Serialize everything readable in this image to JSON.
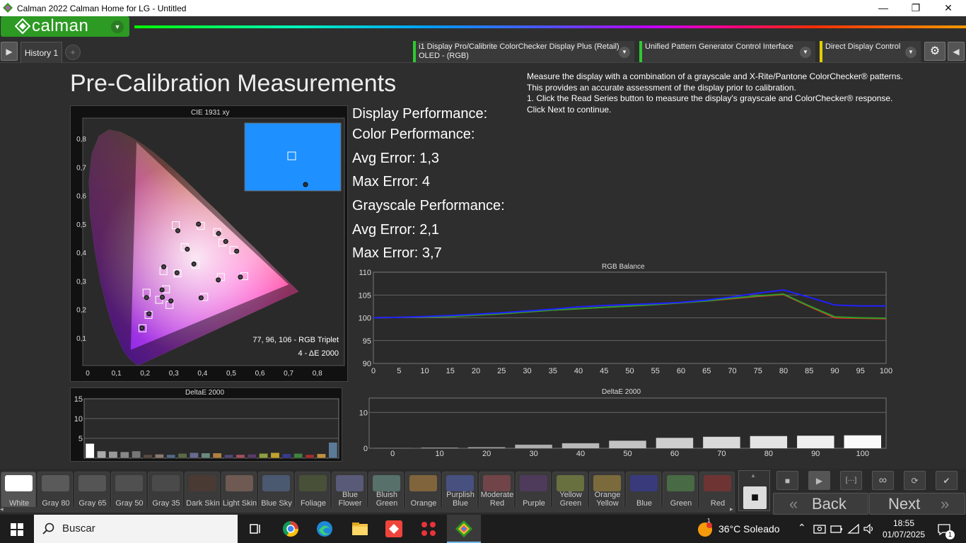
{
  "window": {
    "title": "Calman 2022 Calman Home for LG  - Untitled",
    "minimize": "—",
    "maximize": "❐",
    "close": "✕"
  },
  "logo": {
    "text": "calman",
    "drop": "▼"
  },
  "tabs": {
    "history": "History 1",
    "add": "+",
    "left_arrow": "▶",
    "right_arrow": "◀"
  },
  "devices": [
    {
      "line1": "i1 Display Pro/Calibrite ColorChecker Display Plus (Retail)",
      "line2": "OLED - (RGB)",
      "color": "#2fc92f"
    },
    {
      "line1": "Unified Pattern Generator Control Interface",
      "line2": "",
      "color": "#2fc92f"
    },
    {
      "line1": "Direct Display Control",
      "line2": "",
      "color": "#e0d000"
    }
  ],
  "page": {
    "title": "Pre-Calibration Measurements",
    "instructions": [
      "Measure the display with a combination of a grayscale and X-Rite/Pantone ColorChecker® patterns.",
      "This provides an accurate assessment of the display prior to calibration.",
      "1. Click the Read Series button to measure the display's grayscale and ColorChecker® response.",
      "Click Next to continue."
    ],
    "display_performance": "Display Performance:",
    "color_performance": "Color Performance:",
    "color_avg": "Avg Error: 1,3",
    "color_max": "Max Error: 4",
    "gray_performance": "Grayscale Performance:",
    "gray_avg": "Avg Error: 2,1",
    "gray_max": "Max Error: 3,7"
  },
  "chart_data": [
    {
      "type": "scatter",
      "title": "CIE 1931 xy",
      "xlim": [
        0,
        0.85
      ],
      "ylim": [
        0,
        0.85
      ],
      "x_ticks": [
        "0",
        "0,1",
        "0,2",
        "0,3",
        "0,4",
        "0,5",
        "0,6",
        "0,7",
        "0,8"
      ],
      "y_ticks": [
        "0,1",
        "0,2",
        "0,3",
        "0,4",
        "0,5",
        "0,6",
        "0,7",
        "0,8"
      ],
      "targets": [
        [
          0.313,
          0.329
        ],
        [
          0.376,
          0.359
        ],
        [
          0.273,
          0.273
        ],
        [
          0.249,
          0.236
        ],
        [
          0.338,
          0.421
        ],
        [
          0.264,
          0.337
        ],
        [
          0.394,
          0.496
        ],
        [
          0.205,
          0.261
        ],
        [
          0.307,
          0.498
        ],
        [
          0.451,
          0.474
        ],
        [
          0.464,
          0.316
        ],
        [
          0.545,
          0.319
        ],
        [
          0.406,
          0.246
        ],
        [
          0.285,
          0.218
        ],
        [
          0.469,
          0.437
        ],
        [
          0.508,
          0.411
        ],
        [
          0.212,
          0.183
        ],
        [
          0.191,
          0.136
        ]
      ],
      "measured": [
        [
          0.311,
          0.331
        ],
        [
          0.37,
          0.362
        ],
        [
          0.259,
          0.271
        ],
        [
          0.26,
          0.245
        ],
        [
          0.347,
          0.414
        ],
        [
          0.265,
          0.352
        ],
        [
          0.386,
          0.502
        ],
        [
          0.205,
          0.244
        ],
        [
          0.314,
          0.479
        ],
        [
          0.456,
          0.469
        ],
        [
          0.455,
          0.306
        ],
        [
          0.532,
          0.316
        ],
        [
          0.395,
          0.243
        ],
        [
          0.29,
          0.232
        ],
        [
          0.481,
          0.441
        ],
        [
          0.519,
          0.407
        ],
        [
          0.214,
          0.187
        ],
        [
          0.189,
          0.137
        ]
      ],
      "annotation_line1": "77, 96, 106 - RGB Triplet",
      "annotation_line2": "4 - ΔE 2000",
      "inset_color": "#1e90ff"
    },
    {
      "type": "line",
      "title": "RGB Balance",
      "x": [
        0,
        5,
        10,
        15,
        20,
        25,
        30,
        35,
        40,
        45,
        50,
        55,
        60,
        65,
        70,
        75,
        80,
        85,
        90,
        95,
        100
      ],
      "x_ticks": [
        "0",
        "5",
        "10",
        "15",
        "20",
        "25",
        "30",
        "35",
        "40",
        "45",
        "50",
        "55",
        "60",
        "65",
        "70",
        "75",
        "80",
        "85",
        "90",
        "95",
        "100"
      ],
      "y_ticks": [
        "90",
        "95",
        "100",
        "105",
        "110"
      ],
      "ylim": [
        90,
        110
      ],
      "series": [
        {
          "color": "#ff2020",
          "values": [
            100,
            100.1,
            100.2,
            100.3,
            100.6,
            100.9,
            101.3,
            101.7,
            102.0,
            102.3,
            102.6,
            102.9,
            103.3,
            103.7,
            104.2,
            104.7,
            105.1,
            102.5,
            100.0,
            99.9,
            99.8
          ]
        },
        {
          "color": "#2aa02a",
          "values": [
            100,
            100.1,
            100.2,
            100.3,
            100.6,
            100.9,
            101.3,
            101.7,
            102.0,
            102.3,
            102.6,
            102.9,
            103.3,
            103.7,
            104.3,
            104.8,
            105.2,
            102.6,
            100.2,
            100.0,
            99.9
          ]
        },
        {
          "color": "#2020ff",
          "values": [
            100,
            100.1,
            100.3,
            100.5,
            100.8,
            101.1,
            101.5,
            101.9,
            102.4,
            102.7,
            102.9,
            103.1,
            103.4,
            103.9,
            104.6,
            105.4,
            106.1,
            104.5,
            102.8,
            102.6,
            102.6
          ]
        }
      ]
    },
    {
      "type": "bar",
      "title": "DeltaE 2000",
      "y_ticks": [
        "5",
        "10",
        "15"
      ],
      "ylim": [
        0,
        15
      ],
      "values": [
        3.7,
        1.8,
        1.7,
        1.6,
        1.8,
        0.9,
        1.0,
        0.9,
        1.2,
        1.4,
        1.3,
        1.3,
        0.9,
        0.9,
        1.0,
        1.2,
        1.4,
        1.1,
        1.2,
        0.9,
        1.1,
        4.0
      ],
      "colors": [
        "#ffffff",
        "#aaaaaa",
        "#999999",
        "#888888",
        "#777777",
        "#5a4a42",
        "#8a7a6e",
        "#526a88",
        "#5a6a48",
        "#6a6a90",
        "#6a8a80",
        "#b08040",
        "#504878",
        "#a05060",
        "#5a3a68",
        "#90a040",
        "#c0a030",
        "#3a3a90",
        "#408040",
        "#a03030",
        "#c09040",
        "#5a7a98"
      ]
    },
    {
      "type": "bar",
      "title": "DeltaE 2000",
      "categories": [
        "0",
        "10",
        "20",
        "30",
        "40",
        "50",
        "60",
        "70",
        "80",
        "90",
        "100"
      ],
      "y_ticks": [
        "10"
      ],
      "ylim": [
        0,
        14
      ],
      "values": [
        0.1,
        0.2,
        0.3,
        1.0,
        1.4,
        2.1,
        2.9,
        3.2,
        3.4,
        3.5,
        3.6
      ]
    }
  ],
  "swatches": [
    {
      "label": "White",
      "color": "#ffffff"
    },
    {
      "label": "Gray 80",
      "color": "#5a5a5a"
    },
    {
      "label": "Gray 65",
      "color": "#555555"
    },
    {
      "label": "Gray 50",
      "color": "#505050"
    },
    {
      "label": "Gray 35",
      "color": "#4a4a4a"
    },
    {
      "label": "Dark Skin",
      "color": "#4a3a34"
    },
    {
      "label": "Light Skin",
      "color": "#6e5a52"
    },
    {
      "label": "Blue Sky",
      "color": "#4a5870"
    },
    {
      "label": "Foliage",
      "color": "#485038"
    },
    {
      "label": "Blue\nFlower",
      "color": "#585a78"
    },
    {
      "label": "Bluish\nGreen",
      "color": "#58706a"
    },
    {
      "label": "Orange",
      "color": "#80643c"
    },
    {
      "label": "Purplish\nBlue",
      "color": "#485080"
    },
    {
      "label": "Moderate\nRed",
      "color": "#704448"
    },
    {
      "label": "Purple",
      "color": "#4e3a5a"
    },
    {
      "label": "Yellow\nGreen",
      "color": "#687040"
    },
    {
      "label": "Orange\nYellow",
      "color": "#7a6a3c"
    },
    {
      "label": "Blue",
      "color": "#383a7c"
    },
    {
      "label": "Green",
      "color": "#486a44"
    },
    {
      "label": "Red",
      "color": "#6e3434"
    }
  ],
  "controls": {
    "back": "Back",
    "next": "Next",
    "back_arrow": "«",
    "next_arrow": "»",
    "stop": "■",
    "play": "▶",
    "read": "[···]",
    "loop": "∞",
    "refresh": "⟳",
    "check": "✔",
    "up": "▲"
  },
  "taskbar": {
    "search": "Buscar",
    "weather": "36°C  Soleado",
    "time": "18:55",
    "date": "01/07/2025",
    "notif": "1"
  }
}
